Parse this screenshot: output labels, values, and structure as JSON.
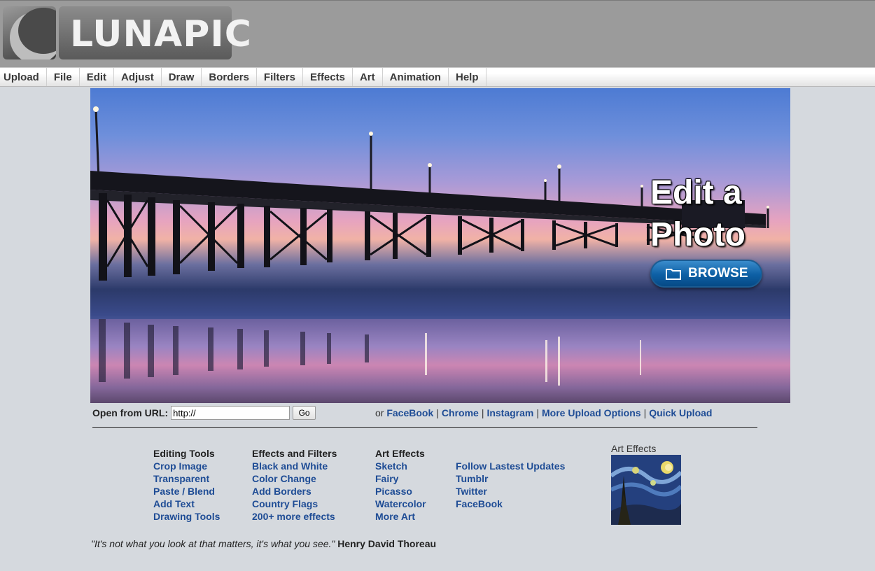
{
  "logo": {
    "text": "LUNAPIC"
  },
  "menu": {
    "items": [
      "Upload",
      "File",
      "Edit",
      "Adjust",
      "Draw",
      "Borders",
      "Filters",
      "Effects",
      "Art",
      "Animation",
      "Help"
    ]
  },
  "hero": {
    "title_line1": "Edit a",
    "title_line2": "Photo",
    "browse_label": "BROWSE",
    "browse_icon": "folder-icon"
  },
  "url_form": {
    "label": "Open from URL:",
    "value": "http://",
    "go_label": "Go"
  },
  "upload_links": {
    "prefix": "or",
    "links": [
      "FaceBook",
      "Chrome",
      "Instagram",
      "More Upload Options",
      "Quick Upload"
    ]
  },
  "columns": {
    "editing": {
      "heading": "Editing Tools",
      "links": [
        "Crop Image",
        "Transparent",
        "Paste / Blend",
        "Add Text",
        "Drawing Tools"
      ]
    },
    "effects": {
      "heading": "Effects and Filters",
      "links": [
        "Black and White",
        "Color Change",
        "Add Borders",
        "Country Flags",
        "200+ more effects"
      ]
    },
    "art": {
      "heading": "Art Effects",
      "links": [
        "Sketch",
        "Fairy",
        "Picasso",
        "Watercolor",
        "More Art"
      ]
    },
    "follow": {
      "links": [
        "Follow Lastest Updates",
        "Tumblr",
        "Twitter",
        "FaceBook"
      ]
    }
  },
  "art_box": {
    "title": "Art Effects"
  },
  "quote": {
    "text": "\"It's not what you look at that matters, it's what you see.\"",
    "author": "Henry David Thoreau"
  },
  "colors": {
    "link": "#1e4c95",
    "background": "#d5d9de",
    "header": "#9b9b9b",
    "browse": "#0d5fa4"
  }
}
